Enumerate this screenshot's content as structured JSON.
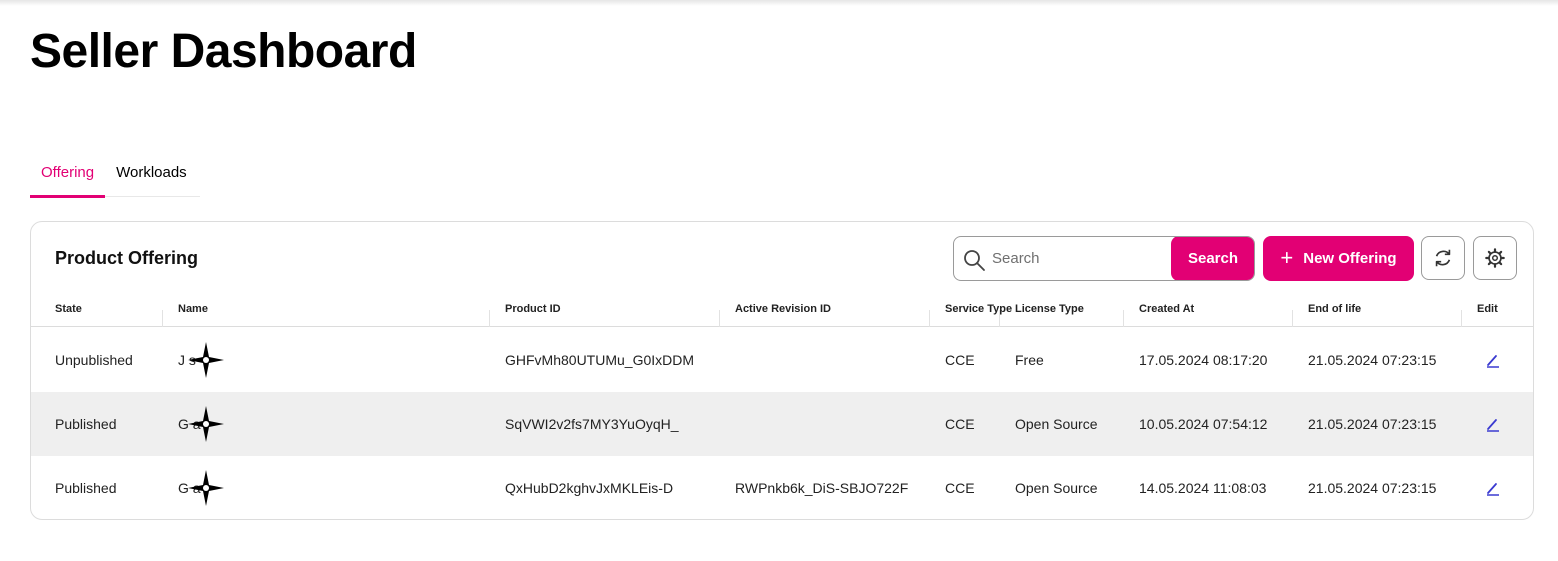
{
  "page": {
    "title": "Seller Dashboard"
  },
  "tabs": [
    {
      "label": "Offering",
      "active": true
    },
    {
      "label": "Workloads",
      "active": false
    }
  ],
  "card": {
    "title": "Product Offering",
    "search": {
      "placeholder": "Search",
      "value": "",
      "button_label": "Search",
      "icon": "search-icon"
    },
    "new_button": {
      "label": "New Offering",
      "icon": "plus-icon"
    },
    "refresh_button": {
      "icon": "refresh-icon"
    },
    "settings_button": {
      "icon": "gear-icon"
    }
  },
  "table": {
    "columns": [
      "State",
      "Name",
      "Product ID",
      "Active Revision ID",
      "Service Type",
      "License Type",
      "Created At",
      "End of life",
      "Edit"
    ],
    "rows": [
      {
        "state": "Unpublished",
        "name_visible": "J        s",
        "product_id": "GHFvMh80UTUMu_G0IxDDM",
        "active_revision_id": "",
        "service_type": "CCE",
        "license_type": "Free",
        "created_at": "17.05.2024 08:17:20",
        "end_of_life": "21.05.2024 07:23:15"
      },
      {
        "state": "Published",
        "name_visible": "G       a",
        "product_id": "SqVWI2v2fs7MY3YuOyqH_",
        "active_revision_id": "",
        "service_type": "CCE",
        "license_type": "Open Source",
        "created_at": "10.05.2024 07:54:12",
        "end_of_life": "21.05.2024 07:23:15"
      },
      {
        "state": "Published",
        "name_visible": "G       a",
        "product_id": "QxHubD2kghvJxMKLEis-D",
        "active_revision_id": "RWPnkb6k_DiS-SBJO722F",
        "service_type": "CCE",
        "license_type": "Open Source",
        "created_at": "14.05.2024 11:08:03",
        "end_of_life": "21.05.2024 07:23:15"
      }
    ]
  },
  "colors": {
    "accent": "#e20074",
    "row_alt": "#efefef",
    "edit_icon": "#3a3ad0",
    "border": "#dcdcdc"
  }
}
